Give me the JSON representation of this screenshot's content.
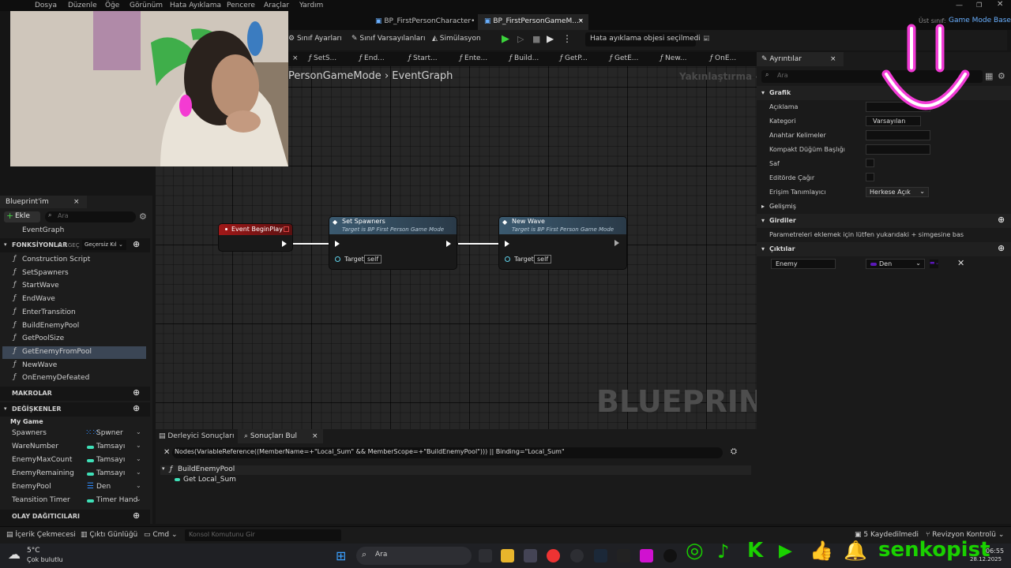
{
  "menu": [
    "Dosya",
    "Düzenle",
    "Öğe",
    "Görünüm",
    "Hata Ayıklama",
    "Pencere",
    "Araçlar",
    "Yardım"
  ],
  "doc_tabs": {
    "tab1": "BP_FirstPersonCharacter•",
    "tab2": "BP_FirstPersonGameM...•",
    "close": "×",
    "parent_label": "Üst sınıf:",
    "parent_value": "Game Mode Base"
  },
  "toolbar": {
    "class_settings": "Sınıf Ayarları",
    "class_defaults": "Sınıf Varsayılanları",
    "simulation": "Simülasyon",
    "debug_object": "Hata ayıklama objesi seçilmedi"
  },
  "function_tabs": [
    "SetS...",
    "End...",
    "Start...",
    "Ente...",
    "Build...",
    "GetP...",
    "GetE...",
    "New...",
    "OnE..."
  ],
  "graph": {
    "breadcrumb_1": "PersonGameMode",
    "sep": "›",
    "breadcrumb_2": "EventGraph",
    "zoom": "Yakınlaştırma -1",
    "watermark": "BLUEPRINT"
  },
  "nodes": {
    "begin_play": {
      "title": "Event BeginPlay"
    },
    "set_spawners": {
      "title": "Set Spawners",
      "subtitle": "Target is BP First Person Game Mode",
      "target_label": "Target",
      "target_value": "self"
    },
    "new_wave": {
      "title": "New Wave",
      "subtitle": "Target is BP First Person Game Mode",
      "target_label": "Target",
      "target_value": "self"
    }
  },
  "left_panel": {
    "tab": "Blueprint'im",
    "add": "Ekle",
    "search_placeholder": "Ara",
    "event_graph": "EventGraph",
    "functions_header": "FONKSİYONLAR",
    "functions_count": "(32 GEÇ",
    "override": "Geçersiz Kıl",
    "functions": [
      "Construction Script",
      "SetSpawners",
      "StartWave",
      "EndWave",
      "EnterTransition",
      "BuildEnemyPool",
      "GetPoolSize",
      "GetEnemyFromPool",
      "NewWave",
      "OnEnemyDefeated"
    ],
    "macros_header": "MAKROLAR",
    "variables_header": "DEĞİŞKENLER",
    "category": "My Game",
    "variables": [
      {
        "name": "Spawners",
        "type": "Spwner",
        "color": "#2f8cff"
      },
      {
        "name": "WareNumber",
        "type": "Tamsayı",
        "color": "#3fe0b8"
      },
      {
        "name": "EnemyMaxCount",
        "type": "Tamsayı",
        "color": "#3fe0b8"
      },
      {
        "name": "EnemyRemaining",
        "type": "Tamsayı",
        "color": "#3fe0b8"
      },
      {
        "name": "EnemyPool",
        "type": "Den",
        "color": "#2f8cff"
      },
      {
        "name": "Teansition Timer",
        "type": "Timer Hand",
        "color": "#3fe0b8"
      }
    ],
    "dispatchers_header": "OLAY DAĞITICILARI"
  },
  "details": {
    "tab": "Ayrıntılar",
    "search_placeholder": "Ara",
    "section_graph": "Grafik",
    "rows": {
      "description": "Açıklama",
      "category": "Kategori",
      "category_value": "Varsayılan",
      "keywords": "Anahtar Kelimeler",
      "compact": "Kompakt Düğüm Başlığı",
      "pure": "Saf",
      "call_in_editor": "Editörde Çağır",
      "access": "Erişim Tanımlayıcı",
      "access_value": "Herkese Açık"
    },
    "advanced": "Gelişmiş",
    "inputs": "Girdiler",
    "inputs_hint": "Parametreleri eklemek için lütfen yukarıdaki + simgesine bas",
    "outputs": "Çıktılar",
    "output_name": "Enemy",
    "output_type": "Den"
  },
  "results": {
    "tab_compiler": "Derleyici Sonuçları",
    "tab_find": "Sonuçları Bul",
    "query": "Nodes(VariableReference((MemberName=+\"Local_Sum\" && MemberScope=+\"BuildEnemyPool\"))) || Binding=\"Local_Sum\"",
    "result_function": "BuildEnemyPool",
    "result_item": "Get Local_Sum"
  },
  "status": {
    "content_drawer": "İçerik Çekmecesi",
    "output_log": "Çıktı Günlüğü",
    "cmd": "Cmd",
    "console_placeholder": "Konsol Komutunu Gir",
    "saved": "5 Kaydedilmedi",
    "revision": "Revizyon Kontrolü"
  },
  "taskbar": {
    "temp": "5°C",
    "weather": "Çok bulutlu",
    "search": "Ara",
    "time": "06:55",
    "date": "28.12.2025",
    "brand": "senkopist"
  }
}
